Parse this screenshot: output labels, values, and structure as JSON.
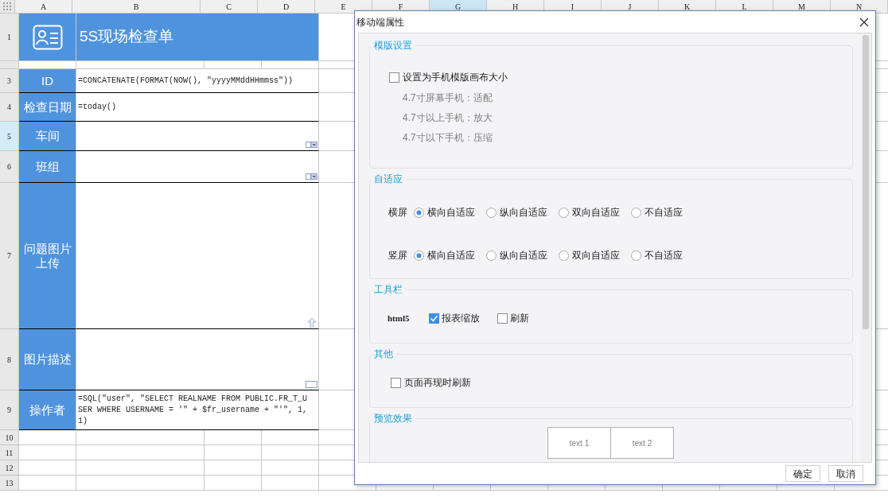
{
  "sheet": {
    "columns": [
      {
        "label": "A",
        "selected": false
      },
      {
        "label": "B",
        "selected": false
      },
      {
        "label": "C",
        "selected": false
      },
      {
        "label": "D",
        "selected": false
      },
      {
        "label": "E",
        "selected": false
      },
      {
        "label": "F",
        "selected": false
      },
      {
        "label": "G",
        "selected": true
      },
      {
        "label": "H",
        "selected": false
      },
      {
        "label": "I",
        "selected": false
      },
      {
        "label": "J",
        "selected": false
      },
      {
        "label": "K",
        "selected": false
      },
      {
        "label": "L",
        "selected": false
      },
      {
        "label": "M",
        "selected": false
      },
      {
        "label": "N",
        "selected": false
      }
    ],
    "rows": [
      {
        "kind": "title",
        "number": "1",
        "selected": false,
        "title": "5S现场检查单"
      },
      {
        "kind": "spacer",
        "selected": false
      },
      {
        "kind": "formula",
        "number": "3",
        "selected": false,
        "label": "ID",
        "value": "=CONCATENATE(FORMAT(NOW(), \"yyyyMMddHHmmss\"))"
      },
      {
        "kind": "formula",
        "number": "4",
        "selected": false,
        "label": "检查日期",
        "value": "=today()"
      },
      {
        "kind": "dropdown",
        "number": "5",
        "selected": true,
        "label": "车间"
      },
      {
        "kind": "dropdown",
        "number": "6",
        "selected": false,
        "label": "班组"
      },
      {
        "kind": "upload",
        "number": "7",
        "selected": false,
        "label": "问题图片上传"
      },
      {
        "kind": "textarea",
        "number": "8",
        "selected": false,
        "label": "图片描述"
      },
      {
        "kind": "formula",
        "number": "9",
        "selected": false,
        "label": "操作者",
        "value": "=SQL(\"user\", \"SELECT REALNAME FROM PUBLIC.FR_T_USER WHERE USERNAME = '\" + $fr_username + \"'\", 1, 1)"
      },
      {
        "kind": "empty",
        "number": "10",
        "selected": false
      },
      {
        "kind": "empty",
        "number": "11",
        "selected": false
      },
      {
        "kind": "empty",
        "number": "12",
        "selected": false
      },
      {
        "kind": "empty",
        "number": "13",
        "selected": false
      }
    ]
  },
  "dialog": {
    "title": "移动端属性",
    "sections": [
      {
        "kind": "template",
        "title": "模版设置",
        "checkbox": {
          "label": "设置为手机模版画布大小",
          "checked": false
        },
        "hints": [
          "4.7寸屏幕手机：适配",
          "4.7寸以上手机：放大",
          "4.7寸以下手机：压缩"
        ]
      },
      {
        "kind": "radios",
        "title": "自适应",
        "rows": [
          {
            "label": "横屏",
            "options": [
              {
                "label": "横向自适应",
                "selected": true
              },
              {
                "label": "纵向自适应",
                "selected": false
              },
              {
                "label": "双向自适应",
                "selected": false
              },
              {
                "label": "不自适应",
                "selected": false
              }
            ]
          },
          {
            "label": "竖屏",
            "options": [
              {
                "label": "横向自适应",
                "selected": true
              },
              {
                "label": "纵向自适应",
                "selected": false
              },
              {
                "label": "双向自适应",
                "selected": false
              },
              {
                "label": "不自适应",
                "selected": false
              }
            ]
          }
        ]
      },
      {
        "kind": "toolbar",
        "title": "工具栏",
        "label": "html5",
        "checkboxes": [
          {
            "label": "报表缩放",
            "checked": true
          },
          {
            "label": "刷新",
            "checked": false
          }
        ]
      },
      {
        "kind": "other",
        "title": "其他",
        "checkbox": {
          "label": "页面再现时刷新",
          "checked": false
        }
      },
      {
        "kind": "preview",
        "title": "预览效果",
        "cells": [
          "text 1",
          "text 2"
        ]
      }
    ],
    "buttons": [
      "确定",
      "取消"
    ]
  }
}
